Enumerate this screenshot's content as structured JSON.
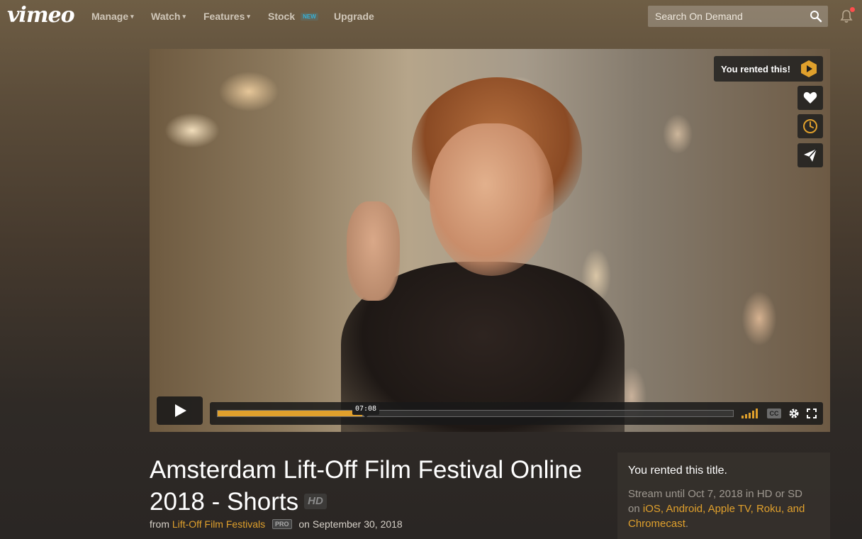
{
  "nav": {
    "logo": "vimeo",
    "items": [
      {
        "label": "Manage",
        "has_dropdown": true
      },
      {
        "label": "Watch",
        "has_dropdown": true
      },
      {
        "label": "Features",
        "has_dropdown": true
      },
      {
        "label": "Stock",
        "badge": "NEW"
      },
      {
        "label": "Upgrade"
      }
    ],
    "search_placeholder": "Search On Demand",
    "notification_dot_color": "#ff4d4d"
  },
  "player": {
    "rented_chip": "You rented this!",
    "side_buttons": [
      "heart-icon",
      "clock-icon",
      "send-icon"
    ],
    "time_tooltip": "07:08",
    "progress_played_fraction": 0.28,
    "progress_loaded_fraction": 0.29,
    "cc_label": "CC",
    "accent_color": "#e0a02c"
  },
  "video": {
    "title": "Amsterdam Lift-Off Film Festival Online 2018 - Shorts",
    "quality_badge": "HD",
    "from_label": "from",
    "channel": "Lift-Off Film Festivals",
    "pro_badge": "PRO",
    "date_text": "on September 30, 2018"
  },
  "rental": {
    "heading": "You rented this title.",
    "stream_text": "Stream until Oct 7, 2018 in HD or SD",
    "on_text": "on",
    "platforms_1": "iOS, Android, Apple TV, Roku, and",
    "platforms_2": "Chromecast",
    "end": "."
  }
}
